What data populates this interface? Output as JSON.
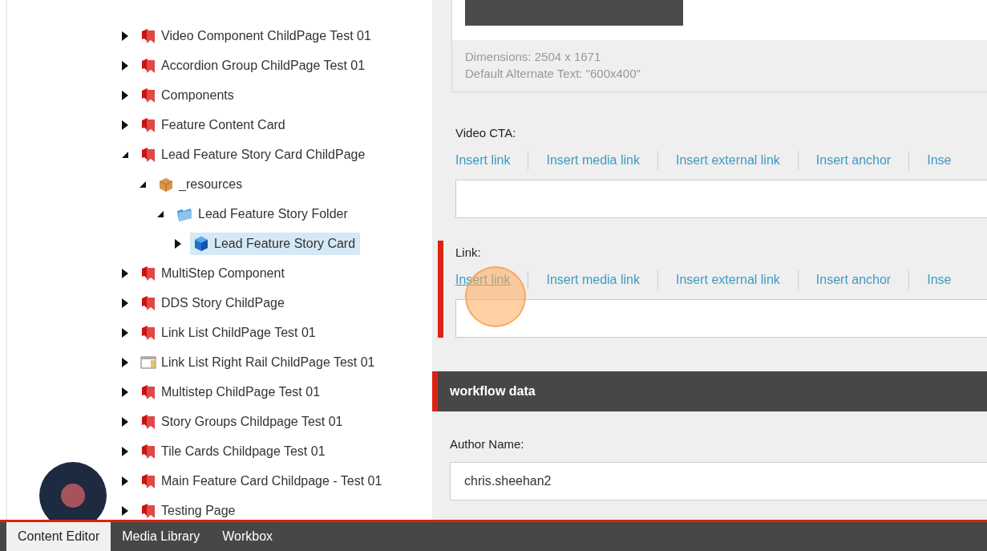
{
  "tree": [
    {
      "label": "Video Component ChildPage Test 01",
      "kind": "page",
      "expanded": false,
      "selected": false
    },
    {
      "label": "Accordion Group ChildPage Test 01",
      "kind": "page",
      "expanded": false,
      "selected": false
    },
    {
      "label": "Components",
      "kind": "page",
      "expanded": false,
      "selected": false
    },
    {
      "label": "Feature Content Card",
      "kind": "page",
      "expanded": false,
      "selected": false
    },
    {
      "label": "Lead Feature Story Card ChildPage",
      "kind": "page",
      "expanded": true,
      "selected": false,
      "children": [
        {
          "label": "_resources",
          "kind": "resources",
          "expanded": true,
          "selected": false,
          "children": [
            {
              "label": "Lead Feature Story Folder",
              "kind": "folder",
              "expanded": true,
              "selected": false,
              "children": [
                {
                  "label": "Lead Feature Story Card",
                  "kind": "item",
                  "expanded": false,
                  "selected": true
                }
              ]
            }
          ]
        }
      ]
    },
    {
      "label": "MultiStep Component",
      "kind": "page",
      "expanded": false,
      "selected": false
    },
    {
      "label": "DDS Story ChildPage",
      "kind": "page",
      "expanded": false,
      "selected": false
    },
    {
      "label": "Link List ChildPage Test 01",
      "kind": "page",
      "expanded": false,
      "selected": false
    },
    {
      "label": "Link List Right Rail ChildPage Test 01",
      "kind": "template",
      "expanded": false,
      "selected": false
    },
    {
      "label": "Multistep ChildPage Test 01",
      "kind": "page",
      "expanded": false,
      "selected": false
    },
    {
      "label": "Story Groups Childpage Test 01",
      "kind": "page",
      "expanded": false,
      "selected": false
    },
    {
      "label": "Tile Cards Childpage Test 01",
      "kind": "page",
      "expanded": false,
      "selected": false
    },
    {
      "label": "Main Feature Card Childpage - Test 01",
      "kind": "page",
      "expanded": false,
      "selected": false
    },
    {
      "label": "Testing Page",
      "kind": "page",
      "expanded": false,
      "selected": false
    }
  ],
  "image_field": {
    "dimensions": "Dimensions: 2504 x 1671",
    "alt_text": "Default Alternate Text: \"600x400\""
  },
  "link_fields": [
    {
      "label": "Video CTA:",
      "invalid": false,
      "links": [
        {
          "label": "Insert link",
          "hovered": false
        },
        {
          "label": "Insert media link",
          "hovered": false
        },
        {
          "label": "Insert external link",
          "hovered": false
        },
        {
          "label": "Insert anchor",
          "hovered": false
        },
        {
          "label": "Inse",
          "hovered": false
        }
      ]
    },
    {
      "label": "Link:",
      "invalid": true,
      "links": [
        {
          "label": "Insert link",
          "hovered": true
        },
        {
          "label": "Insert media link",
          "hovered": false
        },
        {
          "label": "Insert external link",
          "hovered": false
        },
        {
          "label": "Insert anchor",
          "hovered": false
        },
        {
          "label": "Inse",
          "hovered": false
        }
      ]
    }
  ],
  "section": {
    "title": "workflow data"
  },
  "workflow_fields": [
    {
      "label": "Author Name:",
      "value": "chris.sheehan2"
    }
  ],
  "bottom_tabs": [
    {
      "label": "Content Editor",
      "selected": true
    },
    {
      "label": "Media Library",
      "selected": false
    },
    {
      "label": "Workbox",
      "selected": false
    }
  ]
}
